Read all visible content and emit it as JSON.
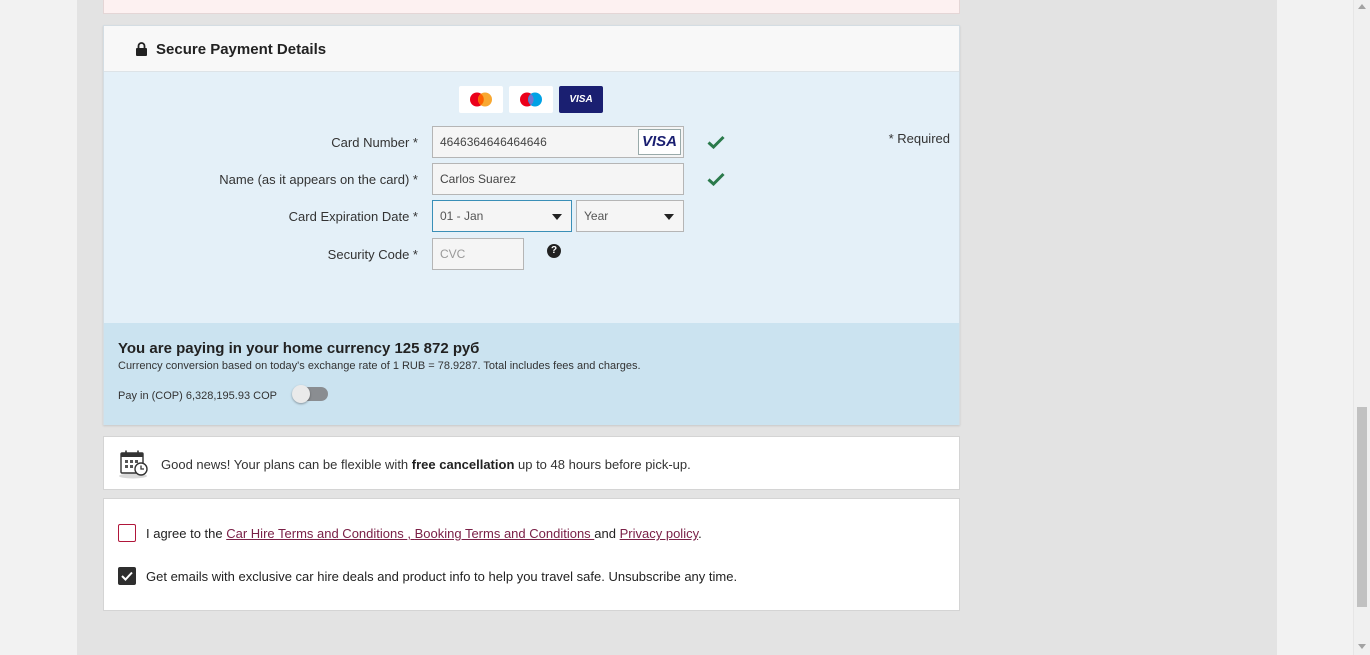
{
  "payment": {
    "title": "Secure Payment Details",
    "card_logos": [
      "mastercard-logo",
      "maestro-logo",
      "visa-logo"
    ],
    "visa_text": "VISA",
    "required_note": "* Required",
    "fields": {
      "card_number": {
        "label": "Card Number *",
        "value": "4646364646464646",
        "badge": "VISA"
      },
      "name": {
        "label": "Name (as it appears on the card) *",
        "value": "Carlos Suarez"
      },
      "expiration": {
        "label": "Card Expiration Date *",
        "month": "01 - Jan",
        "year": "Year"
      },
      "security_code": {
        "label": "Security Code *",
        "placeholder": "CVC"
      }
    }
  },
  "currency": {
    "title": "You are paying in your home currency 125 872 руб",
    "subtitle": "Currency conversion based on today's exchange rate of 1 RUB = 78.9287. Total includes fees and charges.",
    "toggle_label": "Pay in (COP) 6,328,195.93 COP",
    "toggle_on": false
  },
  "info": {
    "text_before": "Good news! Your plans can be flexible with ",
    "bold": "free cancellation",
    "text_after": " up to 48 hours before pick-up."
  },
  "terms": {
    "agree_prefix": "I agree to the ",
    "link1": "Car Hire Terms and Conditions ",
    "sep": ", ",
    "link2": "Booking Terms and Conditions ",
    "and": "and ",
    "link3": "Privacy policy",
    "end": ".",
    "agree_checked": false,
    "emails_text": "Get emails with exclusive car hire deals and product info to help you travel safe. Unsubscribe any time.",
    "emails_checked": true
  },
  "colors": {
    "check_green": "#2a7a4b",
    "link_color": "#7a2047",
    "panel_blue": "#e4f0f8",
    "currency_blue": "#cbe3f0"
  }
}
